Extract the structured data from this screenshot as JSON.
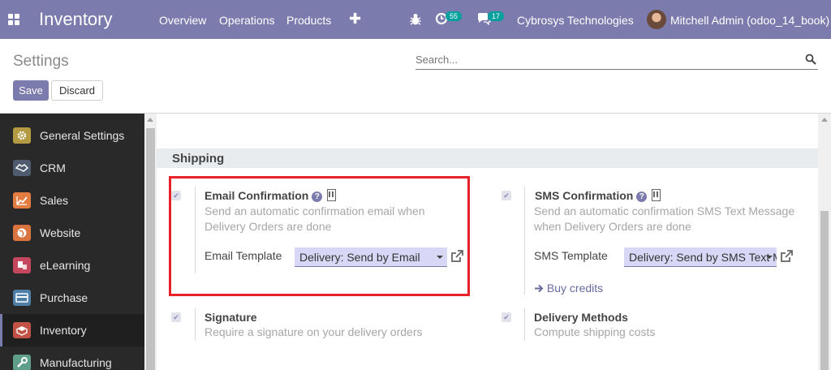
{
  "navbar": {
    "app_name": "Inventory",
    "menu": [
      "Overview",
      "Operations",
      "Products"
    ],
    "plus_icon": "plus-icon",
    "activity_count": "55",
    "message_count": "17",
    "company": "Cybrosys Technologies",
    "user": "Mitchell Admin (odoo_14_book)",
    "accent_color": "#7c7bad"
  },
  "control_panel": {
    "title": "Settings",
    "search_placeholder": "Search...",
    "save_label": "Save",
    "discard_label": "Discard"
  },
  "sidebar": {
    "items": [
      {
        "label": "General Settings",
        "icon": "gear-icon",
        "color": "#b59a44"
      },
      {
        "label": "CRM",
        "icon": "handshake-icon",
        "color": "#4f5b6e"
      },
      {
        "label": "Sales",
        "icon": "chart-icon",
        "color": "#e27c40"
      },
      {
        "label": "Website",
        "icon": "globe-icon",
        "color": "#d9743f"
      },
      {
        "label": "eLearning",
        "icon": "elearning-icon",
        "color": "#c4475d"
      },
      {
        "label": "Purchase",
        "icon": "purchase-card-icon",
        "color": "#4d7fa8"
      },
      {
        "label": "Inventory",
        "icon": "inventory-box-icon",
        "color": "#c25245"
      },
      {
        "label": "Manufacturing",
        "icon": "wrench-icon",
        "color": "#5f9e8a"
      }
    ],
    "active": "Inventory"
  },
  "main": {
    "section_title": "Shipping",
    "email_confirmation": {
      "title": "Email Confirmation",
      "description": "Send an automatic confirmation email when Delivery Orders are done",
      "template_label": "Email Template",
      "template_value": "Delivery: Send by Email"
    },
    "sms_confirmation": {
      "title": "SMS Confirmation",
      "description": "Send an automatic confirmation SMS Text Message when Delivery Orders are done",
      "template_label": "SMS Template",
      "template_value": "Delivery: Send by SMS Text Message",
      "buy_credits": "Buy credits"
    },
    "signature": {
      "title": "Signature",
      "description": "Require a signature on your delivery orders"
    },
    "delivery_methods": {
      "title": "Delivery Methods",
      "description": "Compute shipping costs"
    }
  }
}
